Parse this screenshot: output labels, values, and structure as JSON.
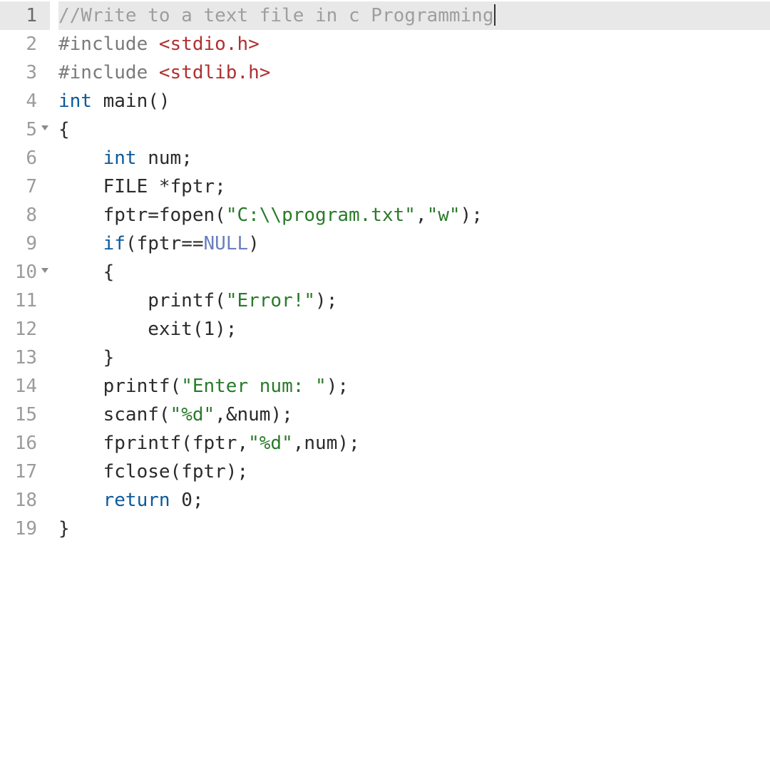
{
  "editor": {
    "active_line": 1,
    "lines": [
      {
        "num": "1",
        "fold": false,
        "active": true,
        "tokens": [
          {
            "t": "//Write to a text file in c Programming",
            "c": "comment"
          }
        ],
        "cursor_after": true
      },
      {
        "num": "2",
        "fold": false,
        "tokens": [
          {
            "t": "#include",
            "c": "preproc"
          },
          {
            "t": " ",
            "c": "punct"
          },
          {
            "t": "<stdio.h>",
            "c": "sysinc"
          }
        ]
      },
      {
        "num": "3",
        "fold": false,
        "tokens": [
          {
            "t": "#include",
            "c": "preproc"
          },
          {
            "t": " ",
            "c": "punct"
          },
          {
            "t": "<stdlib.h>",
            "c": "sysinc"
          }
        ]
      },
      {
        "num": "4",
        "fold": false,
        "tokens": [
          {
            "t": "int",
            "c": "type"
          },
          {
            "t": " main()",
            "c": "ident"
          }
        ]
      },
      {
        "num": "5",
        "fold": true,
        "tokens": [
          {
            "t": "{",
            "c": "punct"
          }
        ]
      },
      {
        "num": "6",
        "fold": false,
        "tokens": [
          {
            "t": "    ",
            "c": "punct"
          },
          {
            "t": "int",
            "c": "type"
          },
          {
            "t": " num;",
            "c": "ident"
          }
        ]
      },
      {
        "num": "7",
        "fold": false,
        "tokens": [
          {
            "t": "    FILE *fptr;",
            "c": "ident"
          }
        ]
      },
      {
        "num": "8",
        "fold": false,
        "tokens": [
          {
            "t": "    fptr=fopen(",
            "c": "ident"
          },
          {
            "t": "\"C:\\\\program.txt\"",
            "c": "string"
          },
          {
            "t": ",",
            "c": "punct"
          },
          {
            "t": "\"w\"",
            "c": "string"
          },
          {
            "t": ");",
            "c": "punct"
          }
        ]
      },
      {
        "num": "9",
        "fold": false,
        "tokens": [
          {
            "t": "    ",
            "c": "punct"
          },
          {
            "t": "if",
            "c": "keyword"
          },
          {
            "t": "(fptr==",
            "c": "ident"
          },
          {
            "t": "NULL",
            "c": "const"
          },
          {
            "t": ")",
            "c": "punct"
          }
        ]
      },
      {
        "num": "10",
        "fold": true,
        "tokens": [
          {
            "t": "    {",
            "c": "punct"
          }
        ]
      },
      {
        "num": "11",
        "fold": false,
        "tokens": [
          {
            "t": "        printf(",
            "c": "ident"
          },
          {
            "t": "\"Error!\"",
            "c": "string"
          },
          {
            "t": ");",
            "c": "punct"
          }
        ]
      },
      {
        "num": "12",
        "fold": false,
        "tokens": [
          {
            "t": "        exit(",
            "c": "ident"
          },
          {
            "t": "1",
            "c": "num"
          },
          {
            "t": ");",
            "c": "punct"
          }
        ]
      },
      {
        "num": "13",
        "fold": false,
        "tokens": [
          {
            "t": "    }",
            "c": "punct"
          }
        ]
      },
      {
        "num": "14",
        "fold": false,
        "tokens": [
          {
            "t": "    printf(",
            "c": "ident"
          },
          {
            "t": "\"Enter num: \"",
            "c": "string"
          },
          {
            "t": ");",
            "c": "punct"
          }
        ]
      },
      {
        "num": "15",
        "fold": false,
        "tokens": [
          {
            "t": "    scanf(",
            "c": "ident"
          },
          {
            "t": "\"%d\"",
            "c": "string"
          },
          {
            "t": ",&num);",
            "c": "ident"
          }
        ]
      },
      {
        "num": "16",
        "fold": false,
        "tokens": [
          {
            "t": "    fprintf(fptr,",
            "c": "ident"
          },
          {
            "t": "\"%d\"",
            "c": "string"
          },
          {
            "t": ",num);",
            "c": "ident"
          }
        ]
      },
      {
        "num": "17",
        "fold": false,
        "tokens": [
          {
            "t": "    fclose(fptr);",
            "c": "ident"
          }
        ]
      },
      {
        "num": "18",
        "fold": false,
        "tokens": [
          {
            "t": "    ",
            "c": "punct"
          },
          {
            "t": "return",
            "c": "keyword"
          },
          {
            "t": " ",
            "c": "punct"
          },
          {
            "t": "0",
            "c": "num"
          },
          {
            "t": ";",
            "c": "punct"
          }
        ]
      },
      {
        "num": "19",
        "fold": false,
        "tokens": [
          {
            "t": "}",
            "c": "punct"
          }
        ]
      }
    ]
  }
}
